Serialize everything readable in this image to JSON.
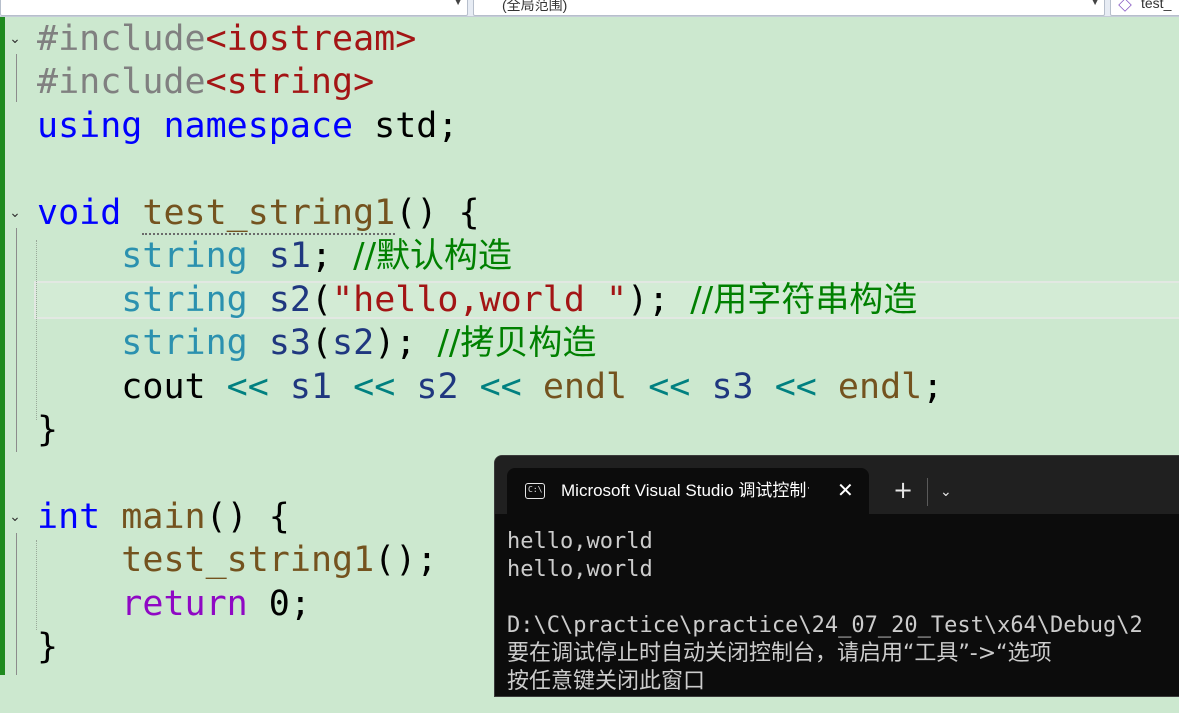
{
  "nav": {
    "combo1": "",
    "combo2": "(全局范围)",
    "combo3": "test_"
  },
  "code": {
    "l1": {
      "pp": "#include",
      "inc": "<iostream>"
    },
    "l2": {
      "pp": "#include",
      "inc": "<string>"
    },
    "l3": {
      "kw1": "using",
      "kw2": "namespace",
      "rest": " std;"
    },
    "l5": {
      "kw": "void",
      "fn": "test_string1",
      "rest": "() {"
    },
    "l6": {
      "ty": "string",
      "var": "s1",
      "punct": ";",
      "cm": "//默认构造"
    },
    "l7": {
      "ty": "string",
      "var": "s2",
      "open": "(",
      "str": "\"hello,world \"",
      "close": ");",
      "cm": "//用字符串构造"
    },
    "l8": {
      "ty": "string",
      "var": "s3",
      "open": "(",
      "arg": "s2",
      "close": ");",
      "cm": "//拷贝构造"
    },
    "l9": {
      "cout": "cout",
      "op1": "<<",
      "v1": "s1",
      "op2": "<<",
      "v2": "s2",
      "op3": "<<",
      "e1": "endl",
      "op4": "<<",
      "v3": "s3",
      "op5": "<<",
      "e2": "endl",
      "end": ";"
    },
    "l10": {
      "brace": "}"
    },
    "l12": {
      "kw": "int",
      "fn": "main",
      "rest": "() {"
    },
    "l13": {
      "fn": "test_string1",
      "rest": "();"
    },
    "l14": {
      "ctl": "return",
      "rest": " 0;"
    },
    "l15": {
      "brace": "}"
    }
  },
  "console": {
    "tab_title": "Microsoft Visual Studio 调试控制台",
    "icon_text": "C:\\",
    "new_tab": "+",
    "close": "✕",
    "dropdown": "⌄",
    "lines": [
      "hello,world",
      "hello,world",
      "",
      "D:\\C\\practice\\practice\\24_07_20_Test\\x64\\Debug\\2",
      "要在调试停止时自动关闭控制台，请启用“工具”->“选项",
      "按任意键关闭此窗口"
    ]
  }
}
